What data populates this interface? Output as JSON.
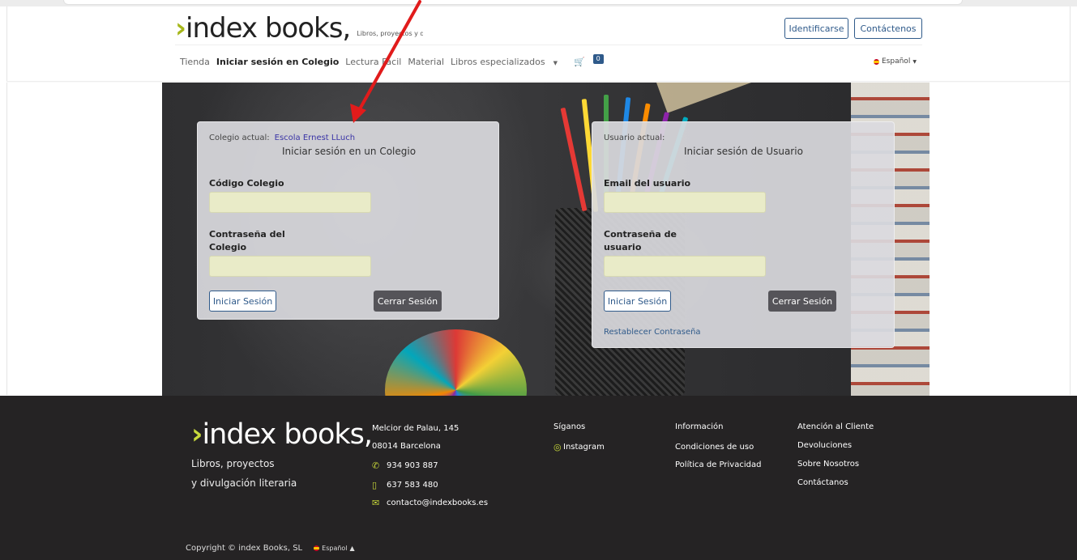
{
  "header": {
    "logo_text": "index books,",
    "logo_tagline": "Libros, proyectos y divulgación literaria",
    "identify_label": "Identificarse",
    "contact_label": "Contáctenos",
    "nav": {
      "shop": "Tienda",
      "school_login": "Iniciar sesión en Colegio",
      "easy_reading": "Lectura Fácil",
      "material": "Material",
      "specialized": "Libros especializados",
      "cart_count": "0"
    },
    "language": "Español"
  },
  "school_panel": {
    "current_label": "Colegio actual:",
    "current_value": "Escola Ernest LLuch",
    "title": "Iniciar sesión en un Colegio",
    "code_label": "Código Colegio",
    "password_label_1": "Contraseña del",
    "password_label_2": "Colegio",
    "login_label": "Iniciar Sesión",
    "logout_label": "Cerrar Sesión"
  },
  "user_panel": {
    "current_label": "Usuario actual:",
    "title": "Iniciar sesión de Usuario",
    "email_label": "Email del usuario",
    "password_label_1": "Contraseña de",
    "password_label_2": "usuario",
    "login_label": "Iniciar Sesión",
    "logout_label": "Cerrar Sesión",
    "reset_label": "Restablecer Contraseña"
  },
  "footer": {
    "logo_text": "index books,",
    "tagline_1": "Libros, proyectos",
    "tagline_2": "y divulgación literaria",
    "address_1": "Melcior de Palau, 145",
    "address_2": "08014 Barcelona",
    "phone": "934 903 887",
    "mobile": "637 583 480",
    "email": "contacto@indexbooks.es",
    "follow_heading": "Síganos",
    "instagram": "Instagram",
    "info_heading": "Información",
    "terms": "Condiciones de uso",
    "privacy": "Política de Privacidad",
    "support_heading": "Atención al Cliente",
    "returns": "Devoluciones",
    "about": "Sobre Nosotros",
    "contact": "Contáctanos",
    "copyright": "Copyright © index Books, SL",
    "language": "Español"
  },
  "colors": {
    "accent": "#2f5a8a",
    "brand_green": "#a6b71a",
    "footer_bg": "#252324",
    "annotation": "#e11b1b"
  }
}
